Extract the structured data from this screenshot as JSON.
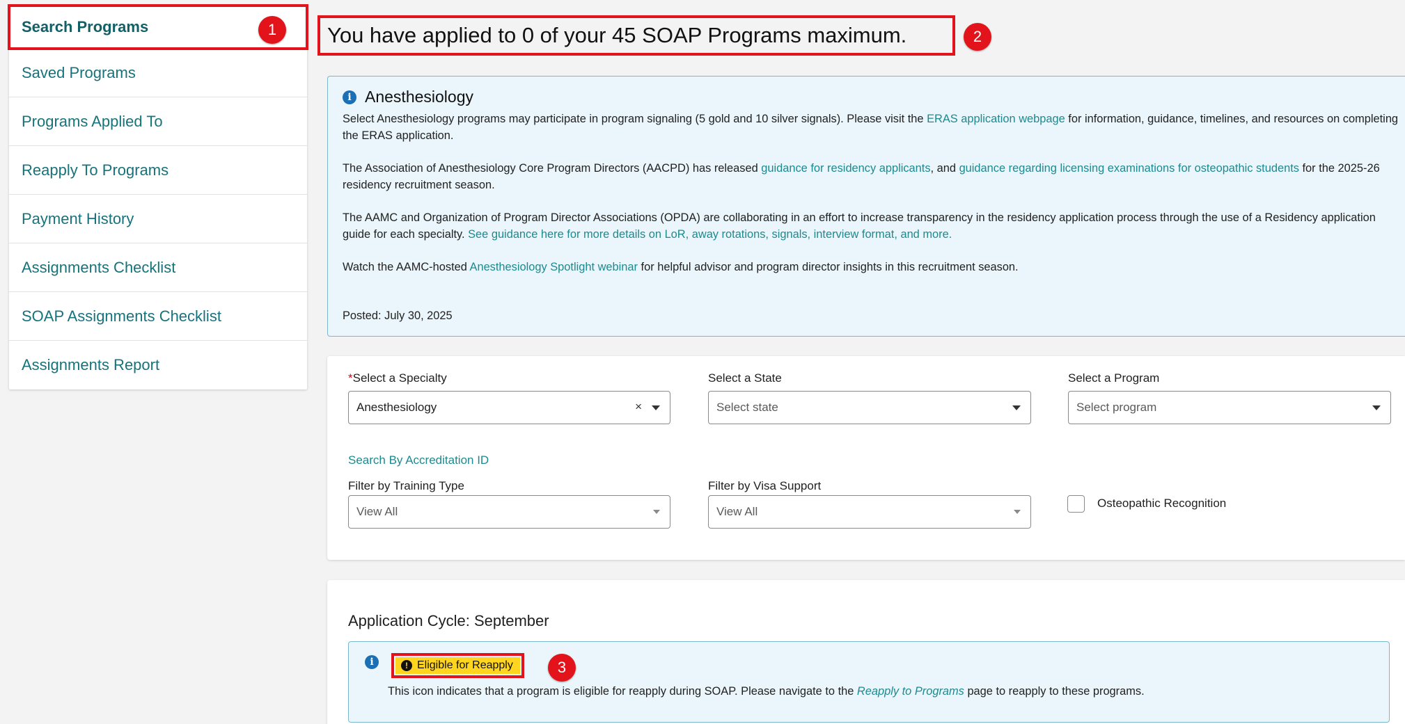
{
  "sidebar": {
    "items": [
      {
        "label": "Search Programs"
      },
      {
        "label": "Saved Programs"
      },
      {
        "label": "Programs Applied To"
      },
      {
        "label": "Reapply To Programs"
      },
      {
        "label": "Payment History"
      },
      {
        "label": "Assignments Checklist"
      },
      {
        "label": "SOAP Assignments Checklist"
      },
      {
        "label": "Assignments Report"
      }
    ]
  },
  "markers": [
    "1",
    "2",
    "3"
  ],
  "header": {
    "applied_text": "You have applied to 0 of your 45 SOAP Programs maximum."
  },
  "info": {
    "title": "Anesthesiology",
    "p1_a": "Select Anesthesiology programs may participate in program signaling (5 gold and 10 silver signals). Please visit the ",
    "p1_link": "ERAS application webpage",
    "p1_b": " for information, guidance, timelines, and resources on completing the ERAS application.",
    "p2_a": "The Association of Anesthesiology Core Program Directors (AACPD) has released ",
    "p2_link1": "guidance for residency applicants",
    "p2_b": ", and ",
    "p2_link2": "guidance regarding licensing examinations for osteopathic students",
    "p2_c": " for the 2025-26 residency recruitment season.",
    "p3_a": "The AAMC and Organization of Program Director Associations (OPDA) are collaborating in an effort to increase transparency in the residency application process through the use of a Residency application guide for each specialty. ",
    "p3_link": "See guidance here for more details on LoR, away rotations, signals, interview format, and more.",
    "p4_a": "Watch the AAMC-hosted ",
    "p4_link": "Anesthesiology Spotlight webinar",
    "p4_b": " for helpful advisor and program director insights in this recruitment season.",
    "posted": "Posted: July 30, 2025"
  },
  "filters": {
    "required_mark": "*",
    "specialty_label": "Select a Specialty",
    "specialty_value": "Anesthesiology",
    "clear_glyph": "×",
    "state_label": "Select a State",
    "state_placeholder": "Select state",
    "program_label": "Select a Program",
    "program_placeholder": "Select program",
    "accreditation_link": "Search By Accreditation ID",
    "training_label": "Filter by Training Type",
    "training_value": "View All",
    "visa_label": "Filter by Visa Support",
    "visa_value": "View All",
    "osteopathic_label": "Osteopathic Recognition"
  },
  "cycle": {
    "title": "Application Cycle: September",
    "badge_label": "Eligible for Reapply",
    "note_a": "This icon indicates that a program is eligible for reapply during SOAP. Please navigate to the ",
    "note_link": "Reapply to Programs",
    "note_b": " page to reapply to these programs."
  },
  "colors": {
    "accent_red": "#e3131c",
    "teal_link": "#1c8a8f",
    "info_bg": "#eaf6fb",
    "badge_yellow": "#ffd51f"
  },
  "icons": [
    "info-icon",
    "exclamation-icon",
    "chevron-down-icon",
    "clear-icon"
  ]
}
